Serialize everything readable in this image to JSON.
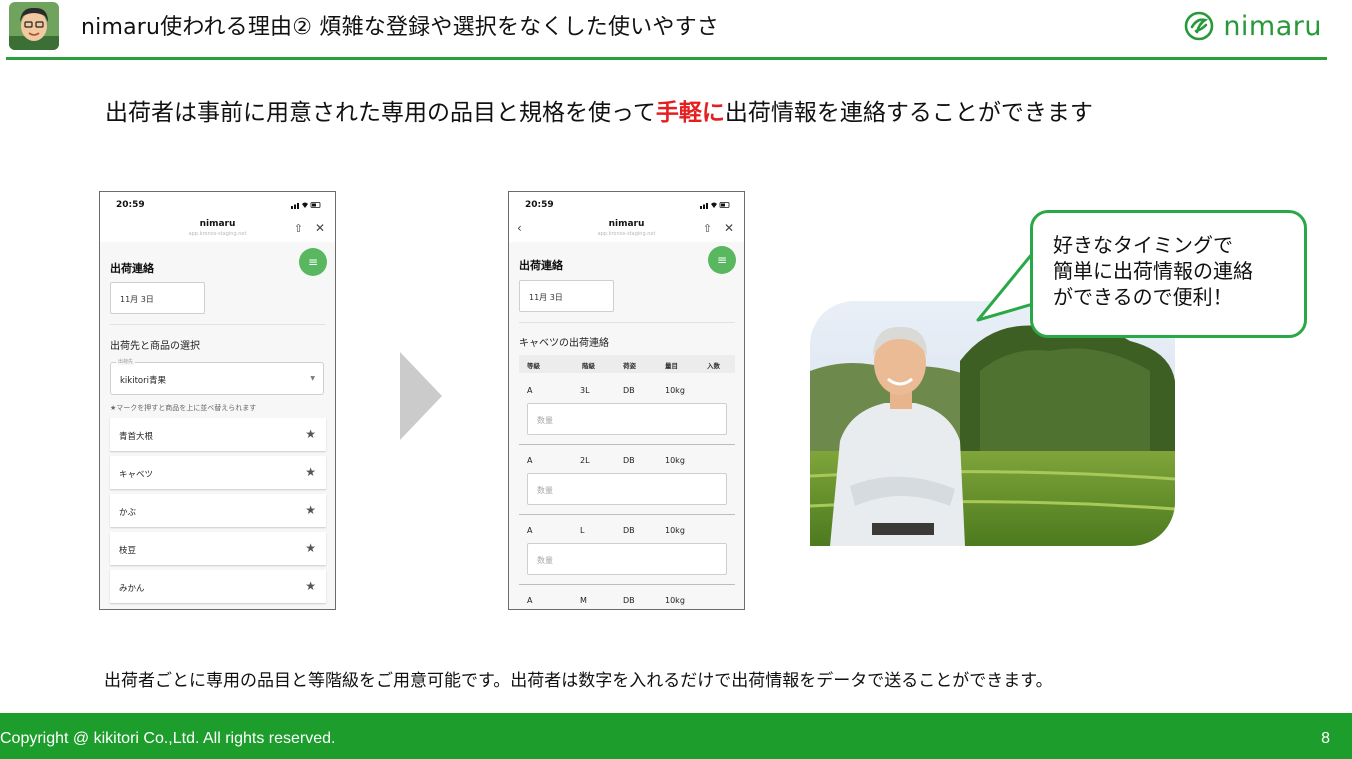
{
  "header": {
    "title": "nimaru使われる理由② 煩雑な登録や選択をなくした使いやすさ",
    "brand": "nimaru"
  },
  "lead": {
    "before": "出荷者は事前に用意された専用の品目と規格を使って",
    "highlight": "手軽に",
    "after": "出荷情報を連絡することができます"
  },
  "phone1": {
    "time": "20:59",
    "app_title": "nimaru",
    "app_url": "app.kronos-staging.net",
    "page_title": "出荷連絡",
    "date": "11月 3日",
    "section_title": "出荷先と商品の選択",
    "select_label": "出荷先",
    "select_value": "kikitori青果",
    "hint": "★マークを押すと商品を上に並べ替えられます",
    "items": [
      "青首大根",
      "キャベツ",
      "かぶ",
      "枝豆",
      "みかん"
    ]
  },
  "phone2": {
    "time": "20:59",
    "app_title": "nimaru",
    "app_url": "app.kronos-staging.net",
    "page_title": "出荷連絡",
    "date": "11月 3日",
    "section_title": "キャベツの出荷連絡",
    "columns": [
      "等級",
      "階級",
      "荷姿",
      "量目",
      "入数"
    ],
    "rows": [
      {
        "grade": "A",
        "class": "3L",
        "package": "DB",
        "weight": "10kg"
      },
      {
        "grade": "A",
        "class": "2L",
        "package": "DB",
        "weight": "10kg"
      },
      {
        "grade": "A",
        "class": "L",
        "package": "DB",
        "weight": "10kg"
      },
      {
        "grade": "A",
        "class": "M",
        "package": "DB",
        "weight": "10kg"
      }
    ],
    "qty_placeholder": "数量"
  },
  "bubble": {
    "line1": "好きなタイミングで",
    "line2": "簡単に出荷情報の連絡",
    "line3": "ができるので便利！"
  },
  "bottom_note": "出荷者ごとに専用の品目と等階級をご用意可能です。出荷者は数字を入れるだけで出荷情報をデータで送ることができます。",
  "footer": {
    "copyright": "Copyright @ kikitori Co.,Ltd. All rights reserved.",
    "page_number": "8"
  },
  "colors": {
    "accent_green": "#1d9e2c",
    "highlight_red": "#e41f1f",
    "fab_green": "#59b85f"
  }
}
